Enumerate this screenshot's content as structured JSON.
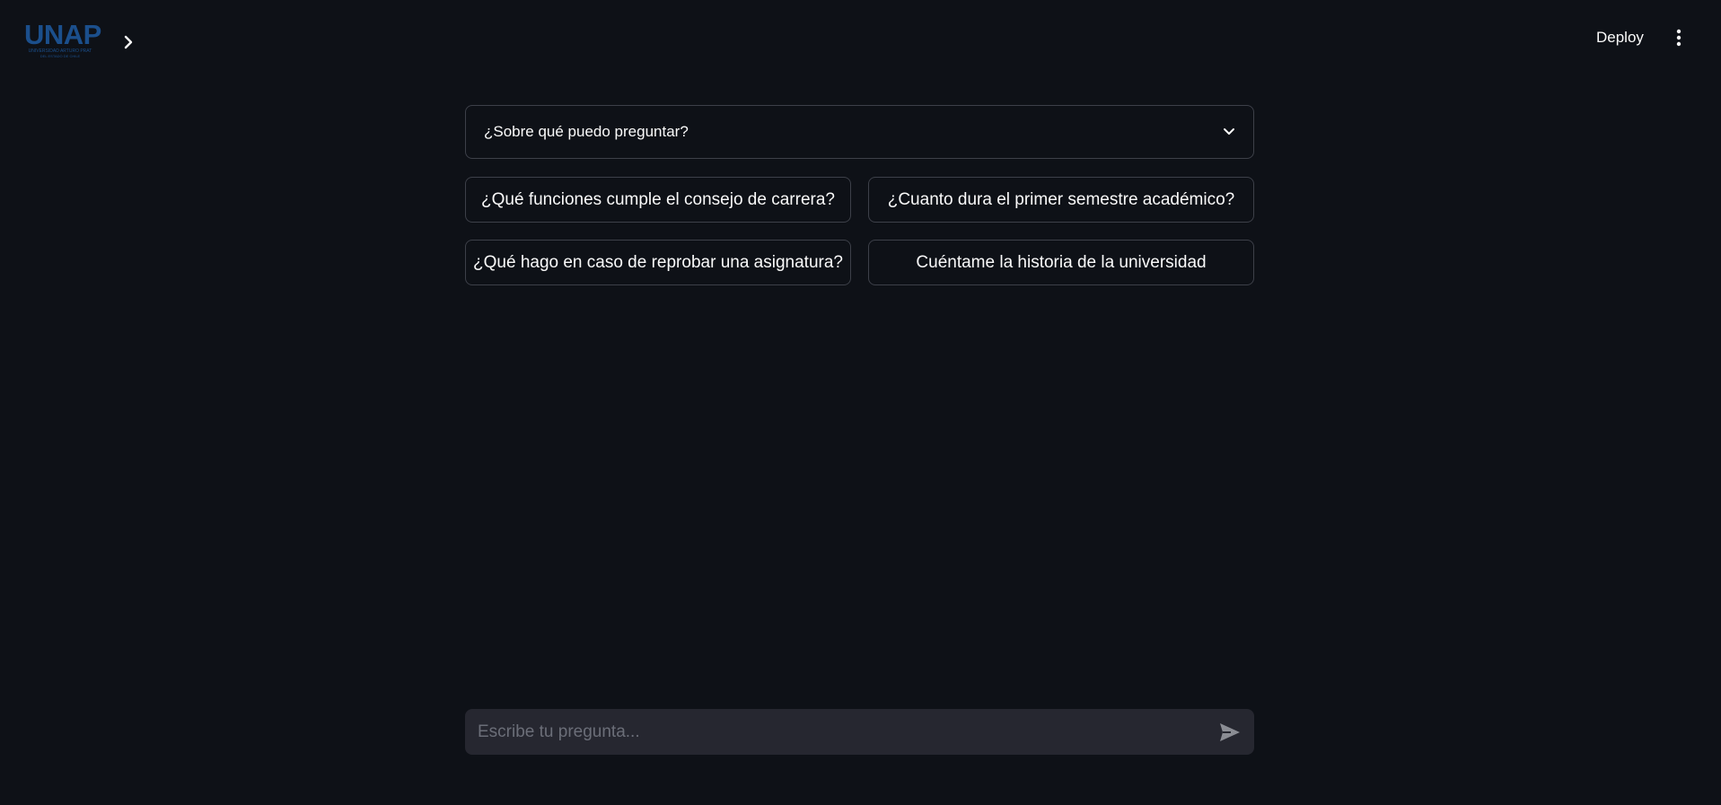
{
  "header": {
    "logo": {
      "text": "UNAP",
      "subtitle": "UNIVERSIDAD ARTURO PRAT",
      "subtitle2": "DEL ESTADO DE CHILE"
    },
    "sidebar_toggle_icon": "chevron-right-icon",
    "deploy_label": "Deploy",
    "menu_icon": "vertical-dots-icon"
  },
  "main": {
    "expander": {
      "label": "¿Sobre qué puedo preguntar?",
      "icon": "chevron-down-icon",
      "expanded": false
    },
    "suggestions": [
      "¿Qué funciones cumple el consejo de carrera?",
      "¿Cuanto dura el primer semestre académico?",
      "¿Qué hago en caso de reprobar una asignatura?",
      "Cuéntame la historia de la universidad"
    ]
  },
  "chat": {
    "placeholder": "Escribe tu pregunta...",
    "value": "",
    "send_icon": "send-icon"
  },
  "colors": {
    "background": "#0e1117",
    "text": "#fafafa",
    "border": "#3d4049",
    "input_background": "#262730",
    "logo": "#1b4f8c"
  }
}
